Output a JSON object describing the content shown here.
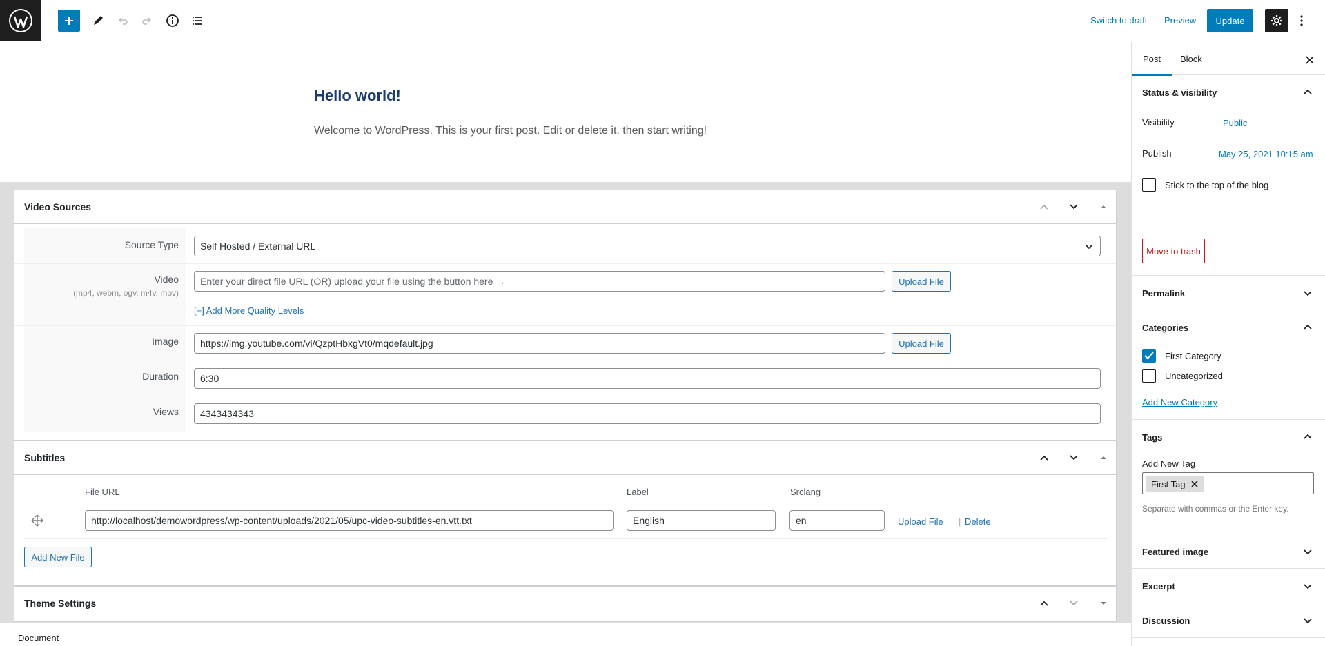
{
  "toolbar": {
    "switch_to_draft": "Switch to draft",
    "preview": "Preview",
    "update": "Update"
  },
  "post": {
    "title": "Hello world!",
    "paragraph": "Welcome to WordPress. This is your first post. Edit or delete it, then start writing!"
  },
  "video_sources": {
    "title": "Video Sources",
    "source_type_label": "Source Type",
    "source_type_value": "Self Hosted / External URL",
    "video_label": "Video",
    "video_formats": "(mp4, webm, ogv, m4v, mov)",
    "video_placeholder": "Enter your direct file URL (OR) upload your file using the button here →",
    "upload_file": "Upload File",
    "add_quality": "[+] Add More Quality Levels",
    "image_label": "Image",
    "image_value": "https://img.youtube.com/vi/QzptHbxgVt0/mqdefault.jpg",
    "duration_label": "Duration",
    "duration_value": "6:30",
    "views_label": "Views",
    "views_value": "4343434343"
  },
  "subtitles": {
    "title": "Subtitles",
    "col_file_url": "File URL",
    "col_label": "Label",
    "col_srclang": "Srclang",
    "row_file_url": "http://localhost/demowordpress/wp-content/uploads/2021/05/upc-video-subtitles-en.vtt.txt",
    "row_label": "English",
    "row_srclang": "en",
    "upload_file": "Upload File",
    "separator": "|",
    "delete": "Delete",
    "add_new_file": "Add New File"
  },
  "theme_settings": {
    "title": "Theme Settings"
  },
  "statusbar": {
    "document": "Document"
  },
  "sidebar": {
    "tab_post": "Post",
    "tab_block": "Block",
    "status_visibility": "Status & visibility",
    "visibility_label": "Visibility",
    "visibility_value": "Public",
    "publish_label": "Publish",
    "publish_value": "May 25, 2021 10:15 am",
    "sticky": "Stick to the top of the blog",
    "move_to_trash": "Move to trash",
    "permalink": "Permalink",
    "categories": "Categories",
    "cat_first": "First Category",
    "cat_uncategorized": "Uncategorized",
    "add_new_category": "Add New Category",
    "tags": "Tags",
    "add_new_tag": "Add New Tag",
    "tag_first": "First Tag",
    "tag_help": "Separate with commas or the Enter key.",
    "featured_image": "Featured image",
    "excerpt": "Excerpt",
    "discussion": "Discussion"
  },
  "colors": {
    "accent": "#007cba",
    "danger": "#cc1818",
    "title": "#1d3b73"
  }
}
